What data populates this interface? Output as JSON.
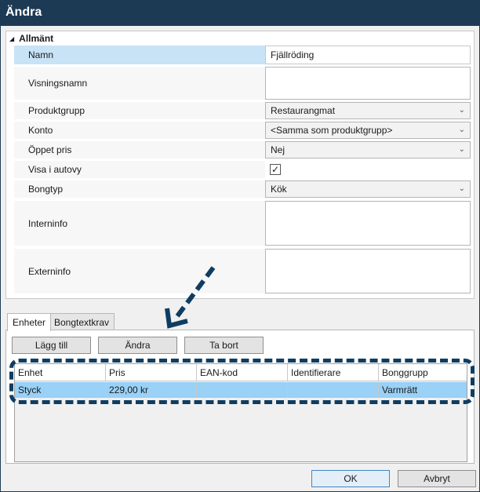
{
  "window": {
    "title": "Ändra"
  },
  "section": {
    "title": "Allmänt",
    "arrow_icon": "collapse-triangle"
  },
  "properties": [
    {
      "label": "Namn",
      "type": "text",
      "value": "Fjällröding"
    },
    {
      "label": "Visningsnamn",
      "type": "multiline",
      "value": ""
    },
    {
      "label": "Produktgrupp",
      "type": "combo",
      "value": "Restaurangmat"
    },
    {
      "label": "Konto",
      "type": "combo",
      "value": "<Samma som produktgrupp>"
    },
    {
      "label": "Öppet pris",
      "type": "combo",
      "value": "Nej"
    },
    {
      "label": "Visa i autovy",
      "type": "checkbox",
      "value": "✓",
      "checked": true
    },
    {
      "label": "Bongtyp",
      "type": "combo",
      "value": "Kök"
    },
    {
      "label": "Interninfo",
      "type": "multiline",
      "value": ""
    },
    {
      "label": "Externinfo",
      "type": "multiline",
      "value": ""
    }
  ],
  "tabs": [
    {
      "label": "Enheter",
      "active": true
    },
    {
      "label": "Bongtextkrav",
      "active": false
    }
  ],
  "actions": {
    "add": "Lägg till",
    "edit": "Ändra",
    "delete": "Ta bort"
  },
  "grid": {
    "columns": [
      "Enhet",
      "Pris",
      "EAN-kod",
      "Identifierare",
      "Bonggrupp"
    ],
    "rows": [
      [
        "Styck",
        "229,00 kr",
        "",
        "",
        "Varmrätt"
      ]
    ]
  },
  "footer": {
    "ok": "OK",
    "cancel": "Avbryt"
  },
  "colors": {
    "titlebar": "#1d3a55",
    "selected_row": "#99d1f7",
    "selected_label": "#c8e3f6",
    "annotation": "#0f3d62"
  }
}
